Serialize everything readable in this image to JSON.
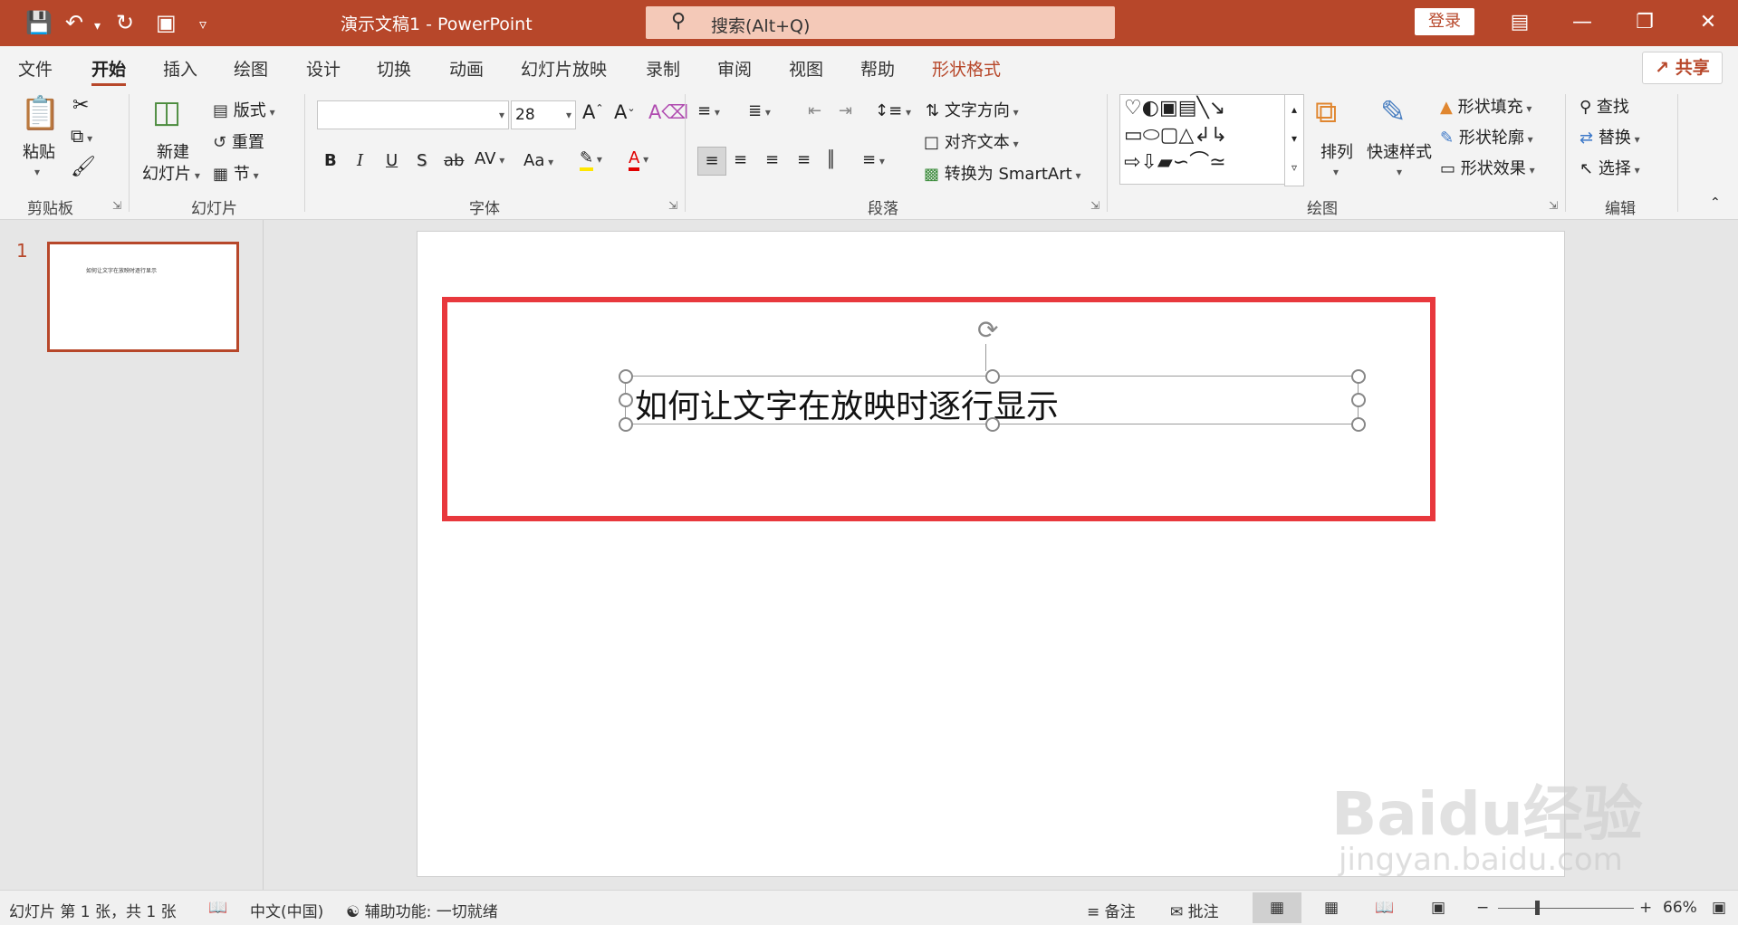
{
  "title_bar": {
    "document_title": "演示文稿1  -  PowerPoint",
    "search_placeholder": "搜索(Alt+Q)",
    "login_label": "登录"
  },
  "menu": {
    "tabs": [
      "文件",
      "开始",
      "插入",
      "绘图",
      "设计",
      "切换",
      "动画",
      "幻灯片放映",
      "录制",
      "审阅",
      "视图",
      "帮助",
      "形状格式"
    ],
    "active_tab": "开始",
    "contextual_tab": "形状格式",
    "share_label": "共享"
  },
  "ribbon": {
    "clipboard": {
      "paste": "粘贴",
      "group": "剪贴板"
    },
    "slides": {
      "new_line1": "新建",
      "new_line2": "幻灯片",
      "layout": "版式",
      "reset": "重置",
      "section": "节",
      "group": "幻灯片"
    },
    "font": {
      "font_name": "",
      "font_size": "28",
      "bold": "B",
      "italic": "I",
      "underline": "U",
      "shadow": "S",
      "strike": "ab",
      "spacing": "AV",
      "case": "Aa",
      "font_color": "A",
      "group": "字体"
    },
    "paragraph": {
      "text_direction": "文字方向",
      "align_text": "对齐文本",
      "smartart": "转换为 SmartArt",
      "group": "段落"
    },
    "drawing": {
      "arrange": "排列",
      "quick_styles": "快速样式",
      "fill": "形状填充",
      "outline": "形状轮廓",
      "effects": "形状效果",
      "group": "绘图"
    },
    "editing": {
      "find": "查找",
      "replace": "替换",
      "select": "选择",
      "group": "编辑"
    }
  },
  "thumbnails": [
    {
      "number": "1",
      "text": "如何让文字在放映时逐行显示"
    }
  ],
  "slide": {
    "textbox_text": "如何让文字在放映时逐行显示",
    "highlight_color": "#e8383d"
  },
  "status_bar": {
    "slide_info": "幻灯片 第 1 张，共 1 张",
    "language": "中文(中国)",
    "accessibility": "辅助功能: 一切就绪",
    "notes": "备注",
    "comments": "批注",
    "zoom": "66%"
  },
  "watermark": {
    "brand": "Baidu经验",
    "url": "jingyan.baidu.com"
  },
  "colors": {
    "accent": "#b7472a",
    "highlight": "#e8383d"
  }
}
